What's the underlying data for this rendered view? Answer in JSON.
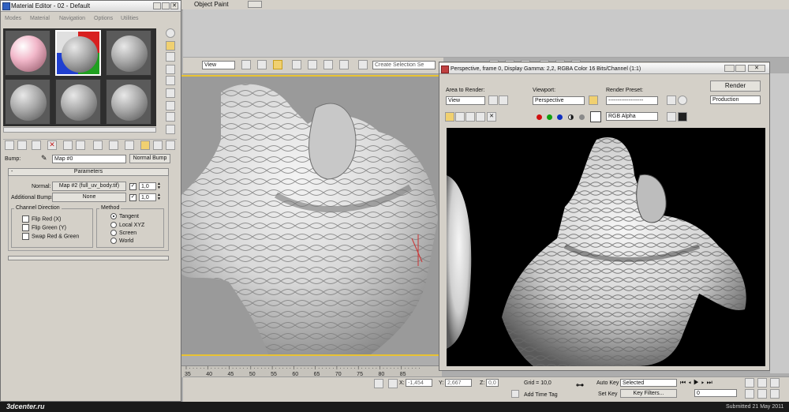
{
  "top_bar": {
    "object_paint": "Object Paint"
  },
  "material_editor": {
    "title": "Material Editor - 02 - Default",
    "menu": [
      "Modes",
      "Material",
      "Navigation",
      "Options",
      "Utilities"
    ],
    "bump_label": "Bump:",
    "map_name": "Map #0",
    "normal_bump_button": "Normal Bump",
    "rollout_title": "Parameters",
    "normal_label": "Normal:",
    "normal_map": "Map #2 (full_uv_body.tif)",
    "normal_amount": "1,0",
    "additional_bump_label": "Additional Bump:",
    "additional_bump_map": "None",
    "additional_amount": "1,0",
    "channel_direction": {
      "title": "Channel Direction",
      "options": [
        "Flip Red (X)",
        "Flip Green (Y)",
        "Swap Red & Green"
      ]
    },
    "method": {
      "title": "Method",
      "options": [
        "Tangent",
        "Local XYZ",
        "Screen",
        "World"
      ],
      "selected": "Tangent"
    }
  },
  "viewport_toolbar": {
    "view_dropdown": "View",
    "selection_set_placeholder": "Create Selection Se"
  },
  "render_window": {
    "title": "Perspective, frame 0, Display Gamma: 2,2, RGBA Color 16 Bits/Channel (1:1)",
    "area_label": "Area to Render:",
    "area_value": "View",
    "viewport_label": "Viewport:",
    "viewport_value": "Perspective",
    "preset_label": "Render Preset:",
    "preset_value": "-------------------",
    "render_button": "Render",
    "production_value": "Production",
    "channel_value": "RGB Alpha",
    "channel_dots": [
      "#d01010",
      "#10a010",
      "#1030c0",
      "#101010",
      "#8a8a8a"
    ]
  },
  "timeline": {
    "ticks": [
      "35",
      "40",
      "45",
      "50",
      "55",
      "60",
      "65",
      "70",
      "75",
      "80",
      "85"
    ]
  },
  "status": {
    "x_label": "X:",
    "x_value": "-1,454",
    "y_label": "Y:",
    "y_value": "2,667",
    "z_label": "Z:",
    "z_value": "0,0",
    "grid": "Grid = 10,0",
    "add_time_tag": "Add Time Tag",
    "auto_key": "Auto Key",
    "selected_value": "Selected",
    "set_key": "Set Key",
    "key_filters": "Key Filters...",
    "frame_value": "0"
  },
  "footer": {
    "logo": "3dcenter.ru",
    "submitted": "Submitted 21 May 2011"
  },
  "colors": {
    "viewport_bg": "#9a9a9a",
    "selection_yellow": "#e8c232",
    "render_bg": "#000000"
  }
}
